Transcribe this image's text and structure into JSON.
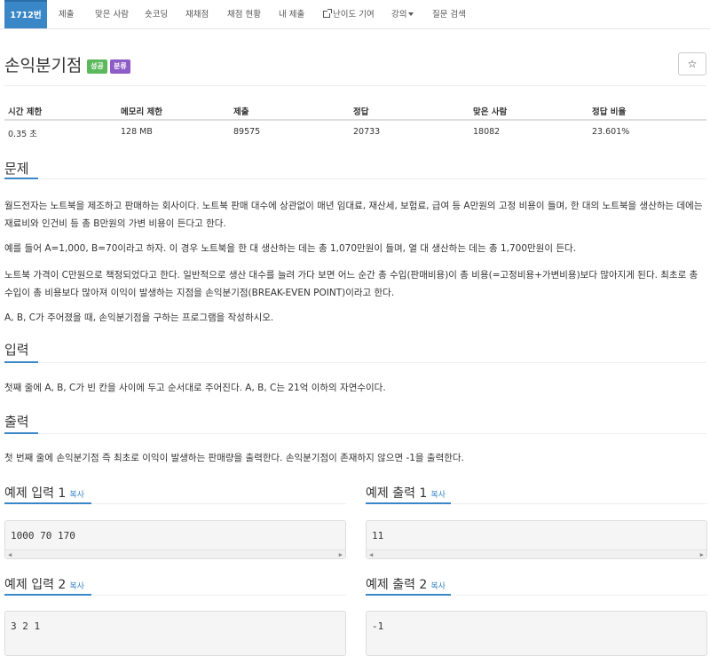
{
  "nav": {
    "tabs": [
      {
        "label": "1712번"
      },
      {
        "label": "제출"
      },
      {
        "label": "맞은 사람"
      },
      {
        "label": "숏코딩"
      },
      {
        "label": "재채점"
      },
      {
        "label": "채점 현황"
      },
      {
        "label": "내 제출"
      },
      {
        "label": "난이도 기여"
      },
      {
        "label": "강의"
      },
      {
        "label": "질문 검색"
      }
    ]
  },
  "problem": {
    "title": "손익분기점",
    "badges": [
      {
        "label": "성공",
        "color": "#5cb85c"
      },
      {
        "label": "분류",
        "color": "#8e5cc6"
      }
    ],
    "star": "☆"
  },
  "stats": {
    "headers": [
      "시간 제한",
      "메모리 제한",
      "제출",
      "정답",
      "맞은 사람",
      "정답 비율"
    ],
    "values": [
      "0.35 초",
      "128 MB",
      "89575",
      "20733",
      "18082",
      "23.601%"
    ]
  },
  "sections": {
    "problem_heading": "문제",
    "problem_paragraphs": [
      "월드전자는 노트북을 제조하고 판매하는 회사이다. 노트북 판매 대수에 상관없이 매년 임대료, 재산세, 보험료, 급여 등 A만원의 고정 비용이 들며, 한 대의 노트북을 생산하는 데에는 재료비와 인건비 등 총 B만원의 가변 비용이 든다고 한다.",
      "예를 들어 A=1,000, B=70이라고 하자. 이 경우 노트북을 한 대 생산하는 데는 총 1,070만원이 들며, 열 대 생산하는 데는 총 1,700만원이 든다.",
      "노트북 가격이 C만원으로 책정되었다고 한다. 일반적으로 생산 대수를 늘려 가다 보면 어느 순간 총 수입(판매비용)이 총 비용(=고정비용+가변비용)보다 많아지게 된다. 최초로 총 수입이 총 비용보다 많아져 이익이 발생하는 지점을 손익분기점(BREAK-EVEN POINT)이라고 한다.",
      "A, B, C가 주어졌을 때, 손익분기점을 구하는 프로그램을 작성하시오."
    ],
    "input_heading": "입력",
    "input_text": "첫째 줄에 A, B, C가 빈 칸을 사이에 두고 순서대로 주어진다. A, B, C는 21억 이하의 자연수이다.",
    "output_heading": "출력",
    "output_text": "첫 번째 줄에 손익분기점 즉 최초로 이익이 발생하는 판매량을 출력한다. 손익분기점이 존재하지 않으면 -1을 출력한다."
  },
  "samples": {
    "copy_label": "복사",
    "input1_title": "예제 입력 1",
    "input1_value": "1000 70 170",
    "output1_title": "예제 출력 1",
    "output1_value": "11",
    "input2_title": "예제 입력 2",
    "input2_value": "3 2 1",
    "output2_title": "예제 출력 2",
    "output2_value": "-1"
  }
}
